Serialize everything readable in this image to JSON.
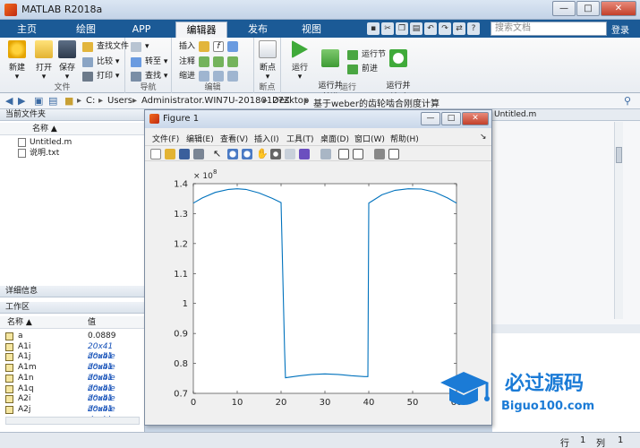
{
  "window": {
    "title": "MATLAB R2018a",
    "minimize": "—",
    "maximize": "□",
    "close": "✕"
  },
  "tabs": [
    {
      "label": "主页",
      "active": false
    },
    {
      "label": "绘图",
      "active": false
    },
    {
      "label": "APP",
      "active": false
    },
    {
      "label": "编辑器",
      "active": true
    },
    {
      "label": "发布",
      "active": false
    },
    {
      "label": "视图",
      "active": false
    }
  ],
  "search": {
    "placeholder": "搜索文档",
    "login": "登录"
  },
  "ribbon": {
    "file": {
      "label": "文件",
      "new": "新建",
      "open": "打开",
      "save": "保存",
      "find_files": "查找文件",
      "compare": "比较",
      "print": "打印"
    },
    "nav": {
      "label": "导航",
      "goto": "转至",
      "find": "查找"
    },
    "edit": {
      "label": "编辑",
      "insert": "插入",
      "comment": "注释",
      "indent": "缩进"
    },
    "breakpoints": {
      "label": "断点",
      "btn": "断点"
    },
    "run": {
      "label": "运行",
      "run": "运行",
      "run_advance": "运行并\n前进",
      "run_section": "运行节",
      "advance": "前进",
      "run_time": "运行并\n计时"
    }
  },
  "address": [
    "C:",
    "Users",
    "Administrator.WIN7U-20180127Z",
    "Desktop",
    "基于weber的齿轮啮合刚度计算"
  ],
  "current_folder": {
    "header": "当前文件夹",
    "col_name": "名称 ▲",
    "files": [
      "Untitled.m",
      "说明.txt"
    ]
  },
  "details_header": "详细信息",
  "workspace": {
    "header": "工作区",
    "col_name": "名称 ▲",
    "col_value": "值",
    "vars": [
      {
        "name": "a",
        "value": "0.0889",
        "plain": true
      },
      {
        "name": "A1i",
        "value": "20x41 double"
      },
      {
        "name": "A1j",
        "value": "20x41 double"
      },
      {
        "name": "A1m",
        "value": "20x41 double"
      },
      {
        "name": "A1n",
        "value": "20x41 double"
      },
      {
        "name": "A1q",
        "value": "20x41 double"
      },
      {
        "name": "A2i",
        "value": "20x41 double"
      },
      {
        "name": "A2j",
        "value": "20x41 double"
      }
    ]
  },
  "editor_tab": "Untitled.m",
  "status": {
    "row_label": "行",
    "row": "1",
    "col_label": "列",
    "col": "1"
  },
  "figure": {
    "title": "Figure 1",
    "menu": [
      "文件(F)",
      "编辑(E)",
      "查看(V)",
      "插入(I)",
      "工具(T)",
      "桌面(D)",
      "窗口(W)",
      "帮助(H)"
    ]
  },
  "chart_data": {
    "type": "line",
    "title": "",
    "xlabel": "",
    "ylabel": "",
    "exponent_label": "× 10",
    "exponent_power": "8",
    "xlim": [
      0,
      60
    ],
    "ylim": [
      0.7,
      1.4
    ],
    "xticks": [
      "0",
      "10",
      "20",
      "30",
      "40",
      "50",
      "60"
    ],
    "yticks": [
      "0.7",
      "0.8",
      "0.9",
      "1",
      "1.1",
      "1.2",
      "1.3",
      "1.4"
    ],
    "color": "#0072bd",
    "x": [
      0,
      2,
      5,
      8,
      10,
      12,
      15,
      18,
      20,
      20.8,
      21,
      24,
      27,
      30,
      33,
      36,
      39,
      39.8,
      40,
      40.5,
      43,
      46,
      49,
      52,
      55,
      58,
      60
    ],
    "y": [
      1.335,
      1.352,
      1.371,
      1.381,
      1.383,
      1.381,
      1.369,
      1.351,
      1.337,
      0.848,
      0.752,
      0.758,
      0.763,
      0.765,
      0.763,
      0.759,
      0.756,
      0.756,
      1.335,
      1.34,
      1.363,
      1.378,
      1.383,
      1.382,
      1.372,
      1.352,
      1.335
    ]
  },
  "watermark": {
    "brand": "必过源码",
    "url": "Biguo100.com"
  }
}
